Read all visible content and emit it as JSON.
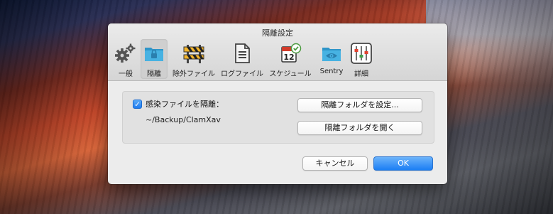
{
  "window": {
    "title": "隔離設定"
  },
  "toolbar": {
    "items": [
      {
        "label": "一般",
        "icon": "gears-icon"
      },
      {
        "label": "隔離",
        "icon": "locked-folder-icon",
        "selected": true
      },
      {
        "label": "除外ファイル",
        "icon": "barrier-icon"
      },
      {
        "label": "ログファイル",
        "icon": "document-icon"
      },
      {
        "label": "スケジュール",
        "icon": "calendar-check-icon"
      },
      {
        "label": "Sentry",
        "icon": "eye-folder-icon"
      },
      {
        "label": "詳細",
        "icon": "sliders-icon"
      }
    ]
  },
  "quarantine": {
    "checkbox_label": "感染ファイルを隔離：",
    "checked": true,
    "path": "~/Backup/ClamXav",
    "set_folder_button": "隔離フォルダを設定...",
    "open_folder_button": "隔離フォルダを開く"
  },
  "footer": {
    "cancel_label": "キャンセル",
    "ok_label": "OK"
  },
  "colors": {
    "accent": "#1b7ef4",
    "folder": "#3fa9d9"
  }
}
